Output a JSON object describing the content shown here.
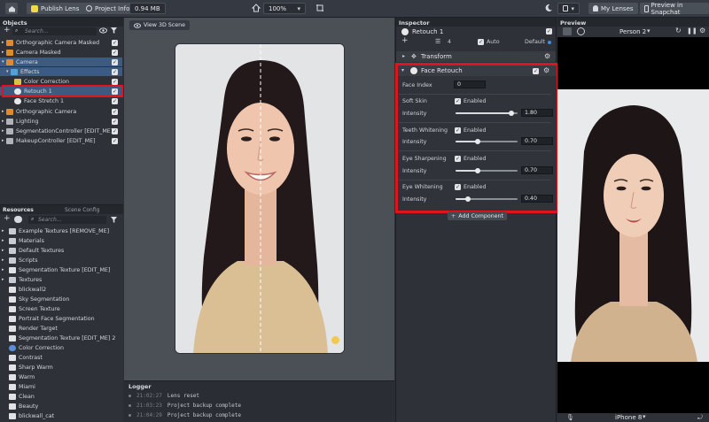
{
  "topbar": {
    "publish_label": "Publish Lens",
    "project_info_label": "Project Info",
    "size_label": "0.94 MB",
    "zoom_value": "100%",
    "my_lenses_label": "My Lenses",
    "preview_snapchat_label": "Preview in Snapchat"
  },
  "objects": {
    "title": "Objects",
    "search_placeholder": "Search...",
    "items": [
      {
        "label": "Orthographic Camera Masked"
      },
      {
        "label": "Camera Masked"
      },
      {
        "label": "Camera"
      },
      {
        "label": "Effects"
      },
      {
        "label": "Color Correction"
      },
      {
        "label": "Retouch 1"
      },
      {
        "label": "Face Stretch 1"
      },
      {
        "label": "Orthographic Camera"
      },
      {
        "label": "Lighting"
      },
      {
        "label": "SegmentationController [EDIT_ME]"
      },
      {
        "label": "MakeupController [EDIT_ME]"
      }
    ]
  },
  "resources": {
    "tab_resources": "Resources",
    "tab_scene_config": "Scene Config",
    "search_placeholder": "Search...",
    "items": [
      {
        "label": "Example Textures [REMOVE_ME]"
      },
      {
        "label": "Materials"
      },
      {
        "label": "Default Textures"
      },
      {
        "label": "Scripts"
      },
      {
        "label": "Segmentation Texture [EDIT_ME]"
      },
      {
        "label": "Textures"
      },
      {
        "label": "blickwall2"
      },
      {
        "label": "Sky Segmentation"
      },
      {
        "label": "Screen Texture"
      },
      {
        "label": "Portrait Face Segmentation"
      },
      {
        "label": "Render Target"
      },
      {
        "label": "Segmentation Texture [EDIT_ME] 2"
      },
      {
        "label": "Color Correction"
      },
      {
        "label": "Contrast"
      },
      {
        "label": "Sharp Warm"
      },
      {
        "label": "Warm"
      },
      {
        "label": "Miami"
      },
      {
        "label": "Clean"
      },
      {
        "label": "Beauty"
      },
      {
        "label": "blickwall_cat"
      }
    ]
  },
  "scene": {
    "view_3d_label": "View 3D Scene"
  },
  "logger": {
    "title": "Logger",
    "lines": [
      {
        "time": "21:02:27",
        "msg": "Lens reset"
      },
      {
        "time": "21:03:23",
        "msg": "Project backup complete"
      },
      {
        "time": "21:04:29",
        "msg": "Project backup complete"
      }
    ]
  },
  "inspector": {
    "title": "Inspector",
    "object_name": "Retouch 1",
    "layer_count": "4",
    "auto_label": "Auto",
    "default_label": "Default",
    "transform_label": "Transform",
    "component_label": "Face Retouch",
    "face_index_label": "Face Index",
    "face_index_value": "0",
    "enabled_label": "Enabled",
    "intensity_label": "Intensity",
    "sections": [
      {
        "label": "Soft Skin",
        "value": "1.80",
        "level": 0.9
      },
      {
        "label": "Teeth Whitening",
        "value": "0.70",
        "level": 0.35
      },
      {
        "label": "Eye Sharpening",
        "value": "0.70",
        "level": 0.35
      },
      {
        "label": "Eye Whitening",
        "value": "0.40",
        "level": 0.2
      }
    ],
    "add_component_label": "Add Component"
  },
  "preview": {
    "title": "Preview",
    "person_label": "Person 2",
    "device_label": "iPhone 8"
  },
  "colors": {
    "highlight": "#e0141e",
    "selection": "#3d5b80"
  }
}
